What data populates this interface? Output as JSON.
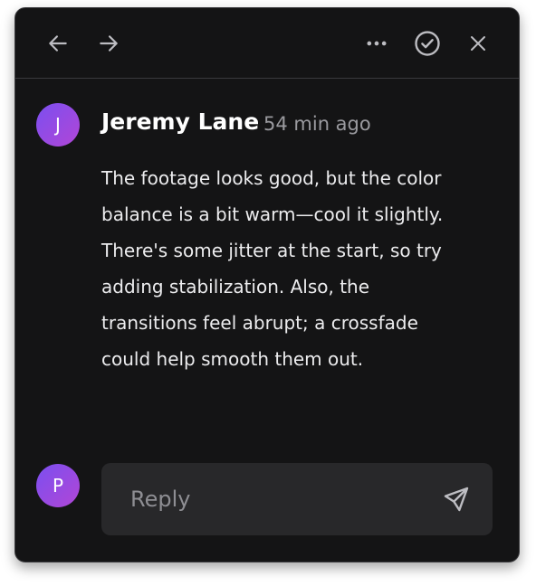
{
  "comment": {
    "author_initial": "J",
    "author": "Jeremy Lane",
    "time": "54 min ago",
    "body": "The footage looks good, but the color balance is a bit warm—cool it slightly. There's some jitter at the start, so try adding stabilization. Also, the transitions feel abrupt; a crossfade could help smooth them out."
  },
  "reply": {
    "user_initial": "P",
    "placeholder": "Reply"
  },
  "toolbar": {
    "icons": [
      "arrow-left-icon",
      "arrow-right-icon",
      "more-icon",
      "check-circle-icon",
      "close-icon"
    ]
  },
  "colors": {
    "panel_bg": "#141415",
    "avatar_gradient_start": "#7b4ff0",
    "avatar_gradient_end": "#b146d6",
    "reply_bg": "#28282a",
    "muted_text": "#9a9a9f"
  }
}
